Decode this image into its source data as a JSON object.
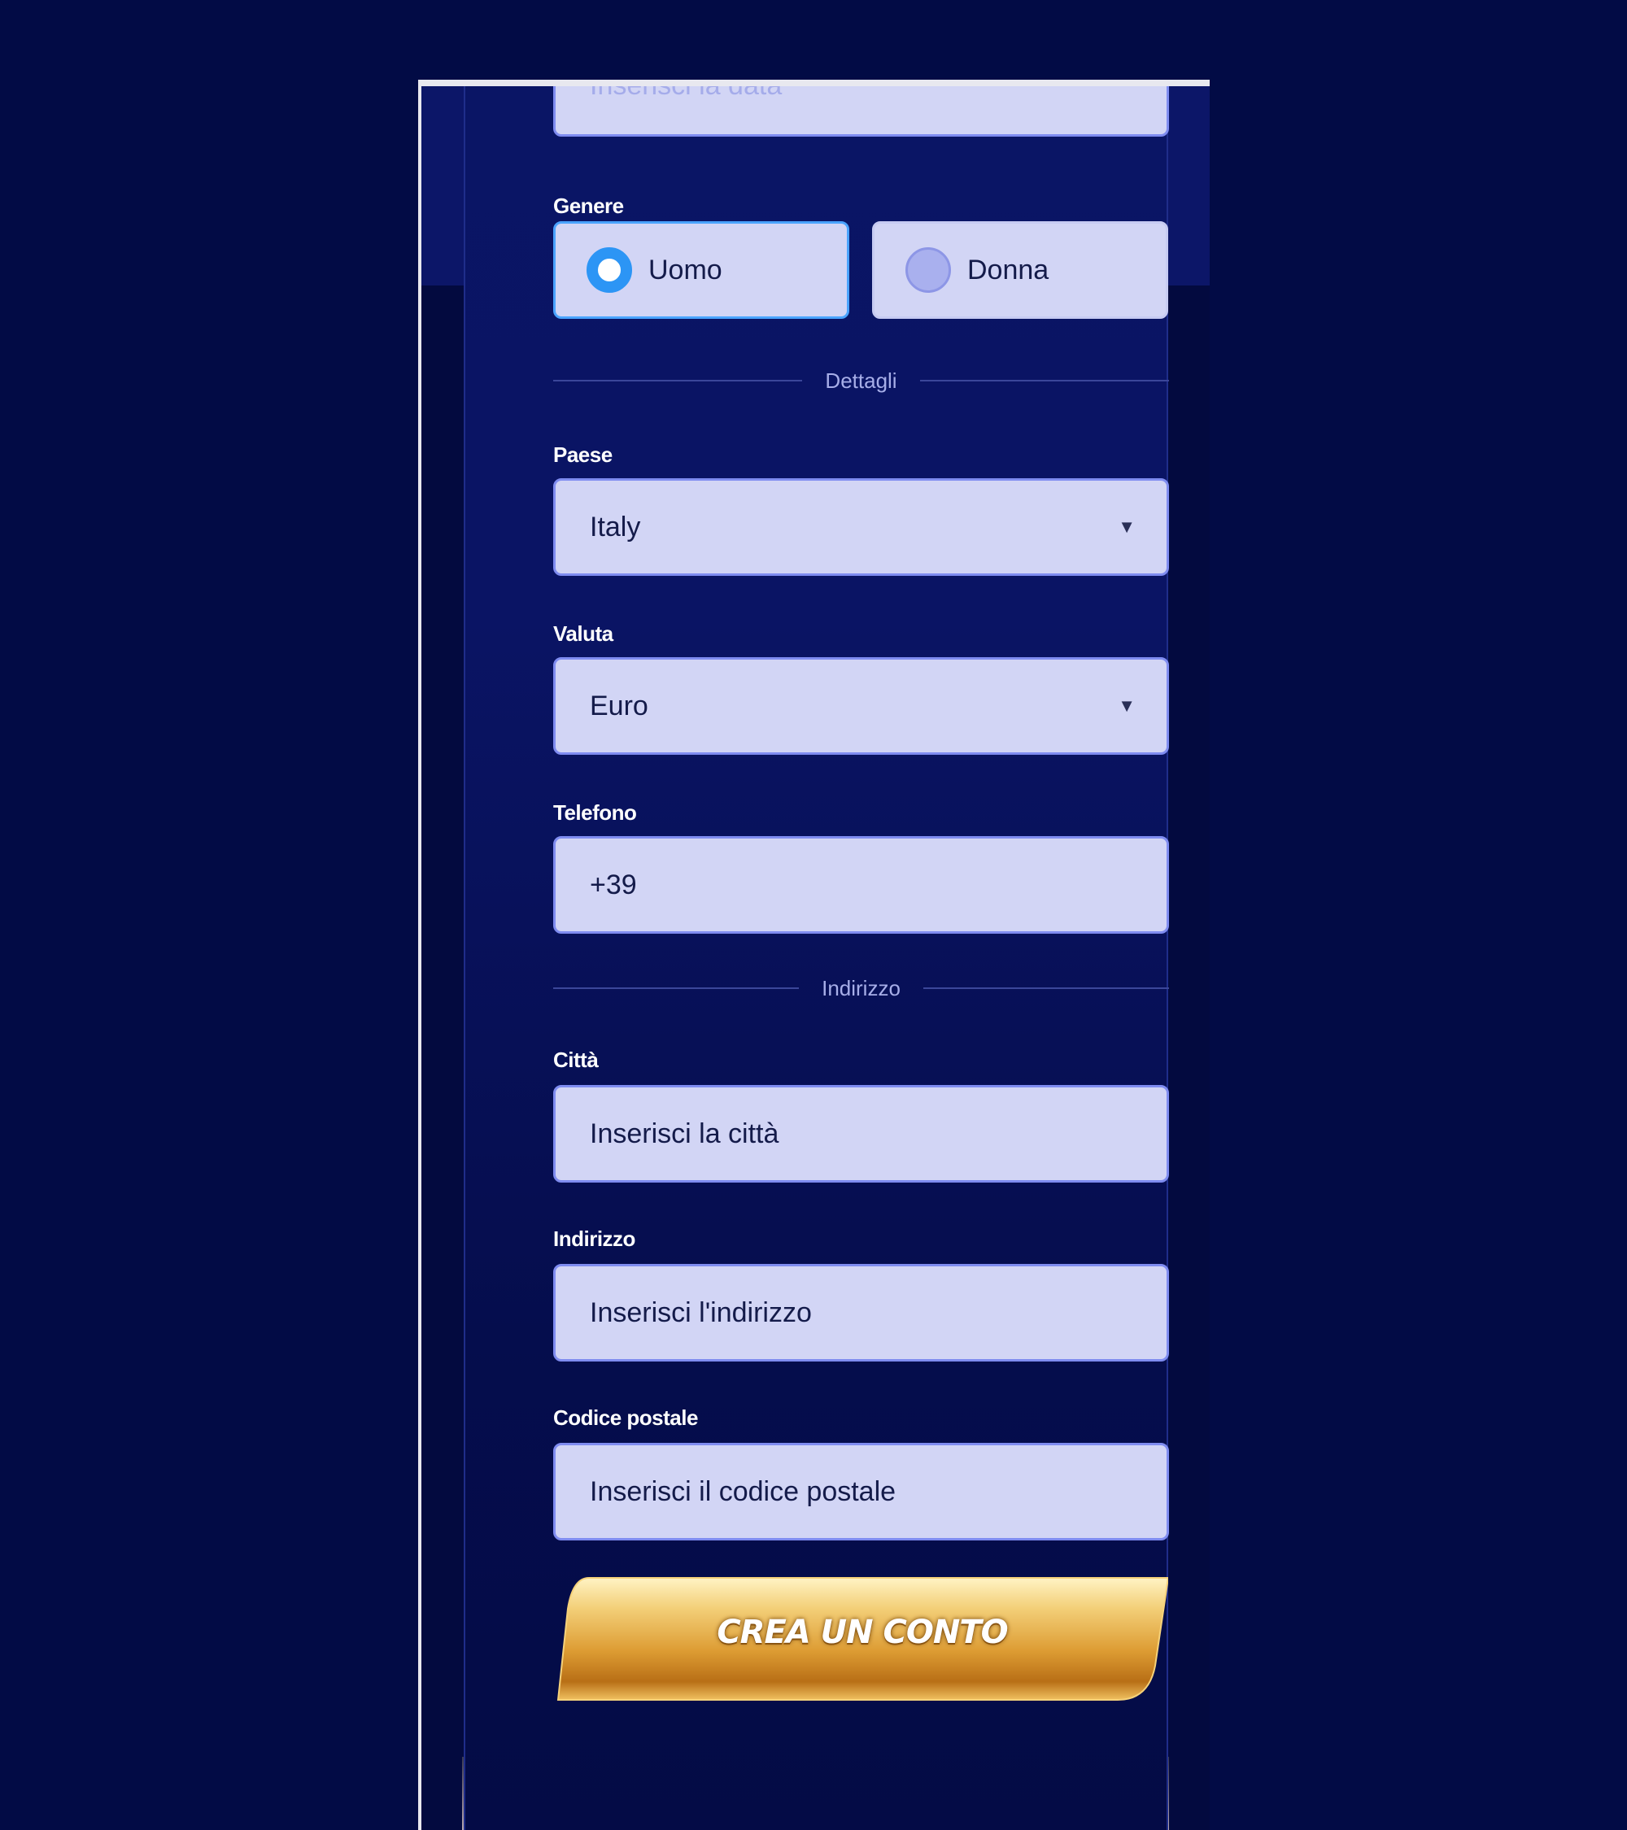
{
  "form": {
    "date_placeholder": "Inserisci la data",
    "gender": {
      "label": "Genere",
      "options": [
        {
          "label": "Uomo",
          "selected": true
        },
        {
          "label": "Donna",
          "selected": false
        }
      ]
    },
    "details_divider": "Dettagli",
    "country": {
      "label": "Paese",
      "value": "Italy"
    },
    "currency": {
      "label": "Valuta",
      "value": "Euro"
    },
    "phone": {
      "label": "Telefono",
      "value": "+39"
    },
    "address_divider": "Indirizzo",
    "city": {
      "label": "Città",
      "placeholder": "Inserisci la città"
    },
    "address": {
      "label": "Indirizzo",
      "placeholder": "Inserisci l'indirizzo"
    },
    "postal": {
      "label": "Codice postale",
      "placeholder": "Inserisci il codice postale"
    },
    "submit_label": "CREA UN CONTO"
  },
  "colors": {
    "page_background": "#020b45",
    "panel": "#0a1464",
    "field": "#d2d5f5",
    "field_border": "#7f8cf0",
    "radio_selected": "#2c95f5",
    "cta_gold": "#e2a43a"
  },
  "icons": {
    "select_caret": "▼"
  }
}
